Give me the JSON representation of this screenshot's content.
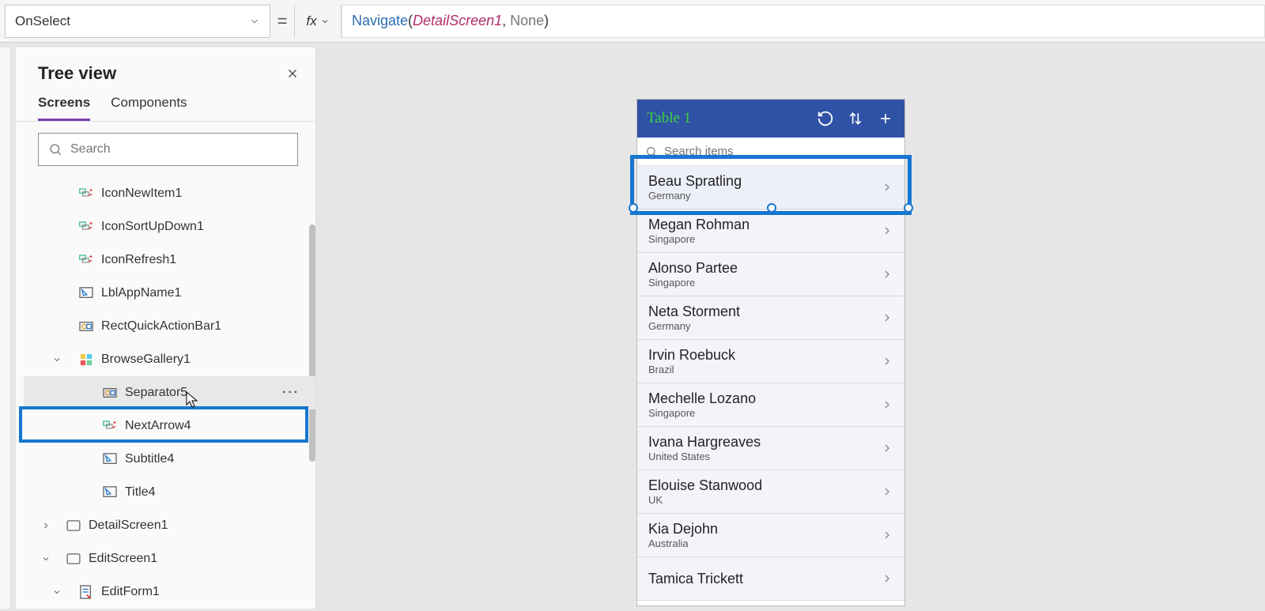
{
  "topbar": {
    "property": "OnSelect",
    "fx_label": "fx",
    "formula": {
      "fn": "Navigate",
      "arg": "DetailScreen1",
      "kw": "None"
    }
  },
  "panel": {
    "title": "Tree view",
    "tabs": {
      "screens": "Screens",
      "components": "Components"
    },
    "search_placeholder": "Search",
    "items": [
      {
        "label": "IconNewItem1",
        "icon": "ctrl-icon",
        "lvl": 2
      },
      {
        "label": "IconSortUpDown1",
        "icon": "ctrl-icon",
        "lvl": 2
      },
      {
        "label": "IconRefresh1",
        "icon": "ctrl-icon",
        "lvl": 2
      },
      {
        "label": "LblAppName1",
        "icon": "label-icon",
        "lvl": 2
      },
      {
        "label": "RectQuickActionBar1",
        "icon": "rect-icon",
        "lvl": 2
      },
      {
        "label": "BrowseGallery1",
        "icon": "gallery-icon",
        "lvl": 2,
        "chev": "down"
      },
      {
        "label": "Separator5",
        "icon": "rect-icon",
        "lvl": 3,
        "selected": true,
        "more": true
      },
      {
        "label": "NextArrow4",
        "icon": "ctrl-icon",
        "lvl": 3
      },
      {
        "label": "Subtitle4",
        "icon": "label-icon",
        "lvl": 3
      },
      {
        "label": "Title4",
        "icon": "label-icon",
        "lvl": 3
      },
      {
        "label": "DetailScreen1",
        "icon": "screen-icon",
        "lvl": 1,
        "chev": "right"
      },
      {
        "label": "EditScreen1",
        "icon": "screen-icon",
        "lvl": 1,
        "chev": "down"
      },
      {
        "label": "EditForm1",
        "icon": "form-icon",
        "lvl": 2,
        "chev": "down"
      }
    ]
  },
  "app": {
    "title": "Table 1",
    "search_placeholder": "Search items",
    "rows": [
      {
        "title": "Beau Spratling",
        "sub": "Germany"
      },
      {
        "title": "Megan Rohman",
        "sub": "Singapore"
      },
      {
        "title": "Alonso Partee",
        "sub": "Singapore"
      },
      {
        "title": "Neta Storment",
        "sub": "Germany"
      },
      {
        "title": "Irvin Roebuck",
        "sub": "Brazil"
      },
      {
        "title": "Mechelle Lozano",
        "sub": "Singapore"
      },
      {
        "title": "Ivana Hargreaves",
        "sub": "United States"
      },
      {
        "title": "Elouise Stanwood",
        "sub": "UK"
      },
      {
        "title": "Kia Dejohn",
        "sub": "Australia"
      },
      {
        "title": "Tamica Trickett",
        "sub": ""
      }
    ]
  }
}
